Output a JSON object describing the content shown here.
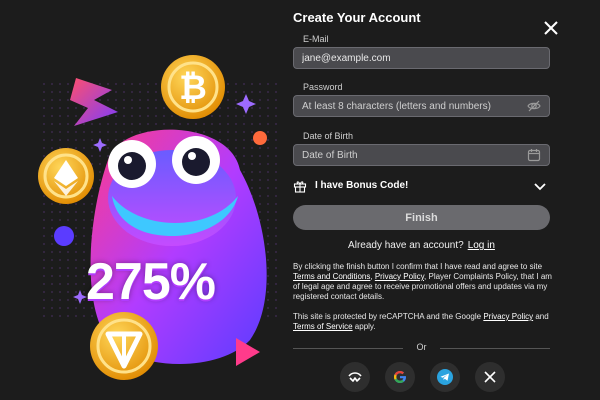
{
  "promo": {
    "bonus_percent": "275%"
  },
  "form": {
    "title": "Create Your Account",
    "email": {
      "label": "E-Mail",
      "value": "jane@example.com"
    },
    "password": {
      "label": "Password",
      "placeholder": "At least 8 characters (letters and numbers)"
    },
    "dob": {
      "label": "Date of Birth",
      "placeholder": "Date of Birth"
    },
    "bonus_label": "I have Bonus Code!",
    "finish_label": "Finish",
    "already_text": "Already have an account?",
    "login_label": "Log in",
    "legal": {
      "p1_a": "By clicking the finish button I confirm that I have read and agree to site ",
      "terms": "Terms and Conditions",
      "p1_b": ", ",
      "privacy": "Privacy Policy",
      "p1_c": ", Player Complaints Policy, that I am of legal age and agree to receive promotional offers and updates via my registered contact details.",
      "p2_a": "This site is protected by reCAPTCHA and the Google ",
      "privacy2": "Privacy Policy",
      "p2_b": " and ",
      "tos": "Terms of Service",
      "p2_c": " apply."
    },
    "or_label": "Or",
    "social": [
      "walletconnect-icon",
      "google-icon",
      "telegram-icon",
      "x-icon"
    ]
  },
  "colors": {
    "background": "#1c1c1c",
    "field_bg": "#4a4a4e",
    "button_bg": "#6a6a6e"
  }
}
